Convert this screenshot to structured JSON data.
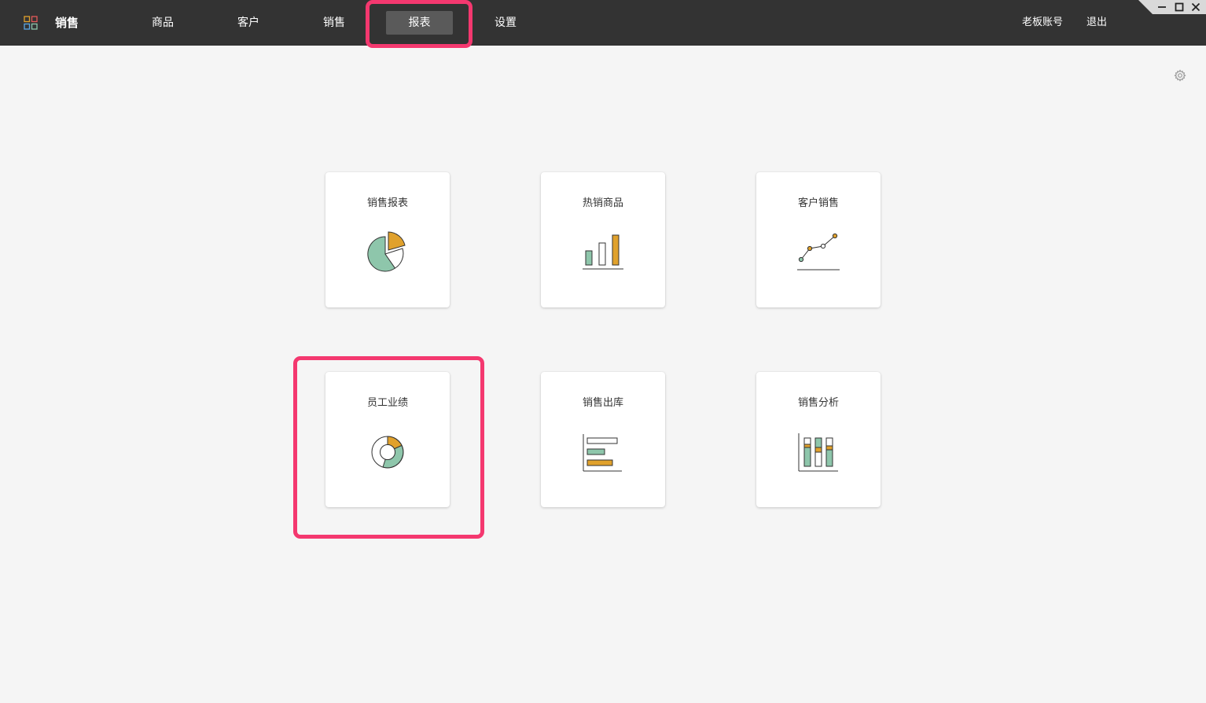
{
  "app": {
    "name": "销售",
    "logo_icon": "apps-grid-icon"
  },
  "nav": [
    {
      "label": "商品",
      "active": false
    },
    {
      "label": "客户",
      "active": false
    },
    {
      "label": "销售",
      "active": false
    },
    {
      "label": "报表",
      "active": true
    },
    {
      "label": "设置",
      "active": false
    }
  ],
  "account": {
    "account_label": "老板账号",
    "logout_label": "退出"
  },
  "window_controls": [
    "minimize-icon",
    "maximize-icon",
    "close-icon"
  ],
  "settings_icon": "gear-icon",
  "reports": [
    {
      "title": "销售报表",
      "icon": "pie-chart-icon"
    },
    {
      "title": "热销商品",
      "icon": "bar-chart-icon"
    },
    {
      "title": "客户销售",
      "icon": "line-chart-icon"
    },
    {
      "title": "员工业绩",
      "icon": "donut-chart-icon"
    },
    {
      "title": "销售出库",
      "icon": "horizontal-bar-chart-icon"
    },
    {
      "title": "销售分析",
      "icon": "stacked-bar-chart-icon"
    }
  ],
  "colors": {
    "topbar": "#333333",
    "active_tab": "#5a5a5a",
    "background": "#f5f5f5",
    "icon_green": "#8ec6ab",
    "icon_orange": "#e0a12c",
    "highlight": "#f4386f"
  }
}
